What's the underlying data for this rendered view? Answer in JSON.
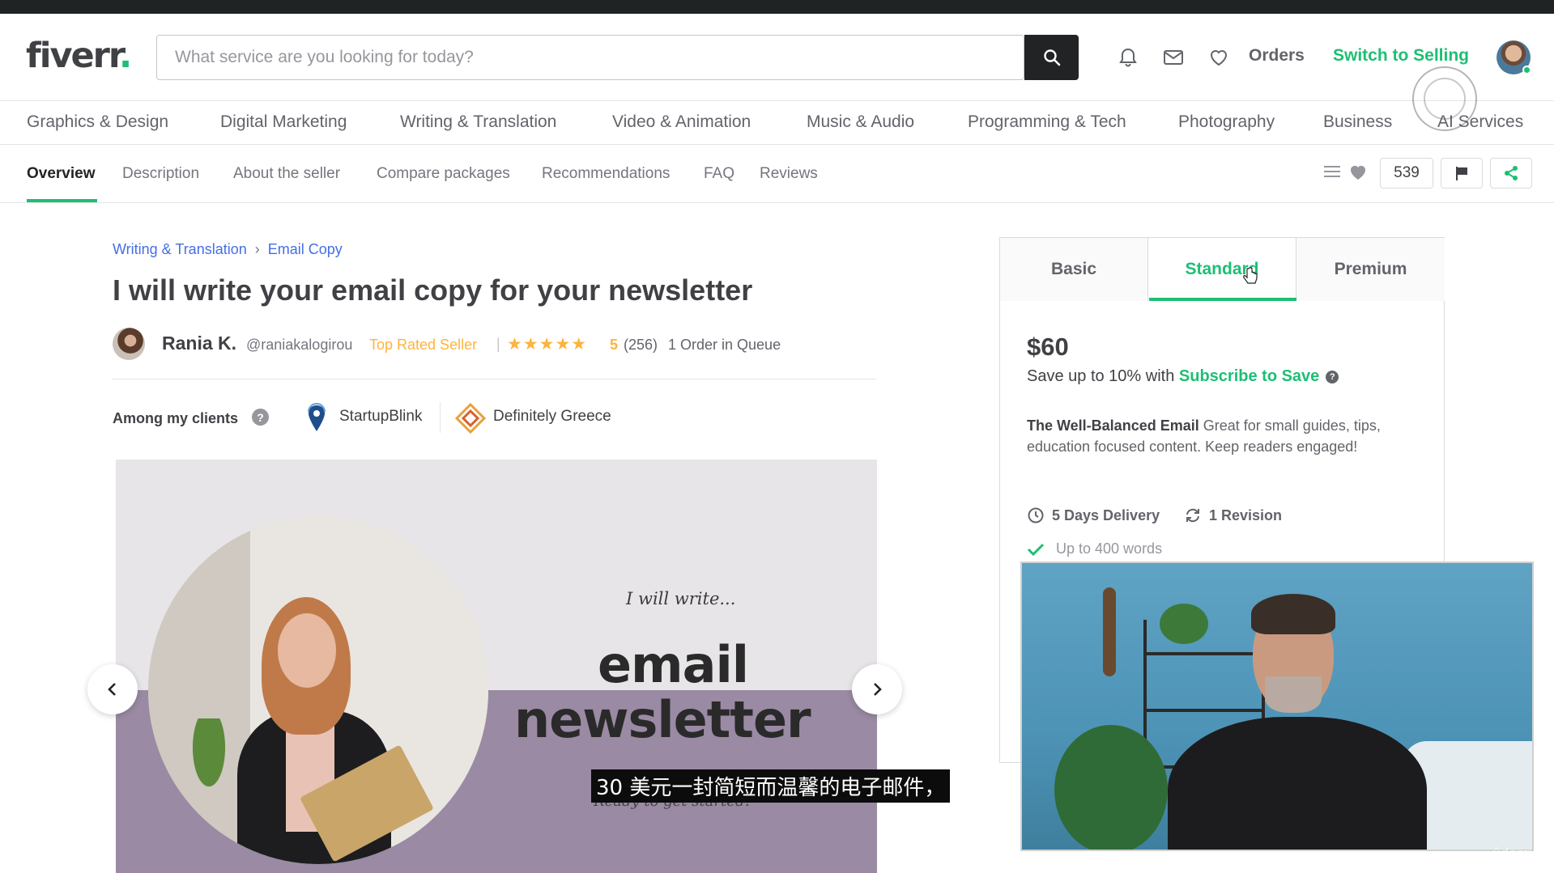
{
  "header": {
    "logo_text": "fiverr",
    "logo_dot": ".",
    "search_placeholder": "What service are you looking for today?",
    "orders_label": "Orders",
    "switch_label": "Switch to Selling",
    "icons": [
      "bell-icon",
      "envelope-icon",
      "heart-icon",
      "search-icon"
    ]
  },
  "categories": [
    "Graphics & Design",
    "Digital Marketing",
    "Writing & Translation",
    "Video & Animation",
    "Music & Audio",
    "Programming & Tech",
    "Photography",
    "Business",
    "AI Services"
  ],
  "subnav": {
    "items": [
      "Overview",
      "Description",
      "About the seller",
      "Compare packages",
      "Recommendations",
      "FAQ",
      "Reviews"
    ],
    "active": "Overview",
    "save_count": "539"
  },
  "breadcrumb": [
    "Writing & Translation",
    "Email Copy"
  ],
  "gig": {
    "title": "I will write your email copy for your newsletter",
    "seller_name": "Rania K.",
    "seller_handle": "@raniakalogirou",
    "seller_level": "Top Rated Seller",
    "stars": "★★★★★",
    "rating": "5",
    "review_count": "(256)",
    "queue": "1 Order in Queue"
  },
  "clients": {
    "label": "Among my clients",
    "items": [
      "StartupBlink",
      "Definitely Greece"
    ]
  },
  "gallery": {
    "kicker": "I will write...",
    "line1": "email",
    "line2": "newsletter",
    "tagline": "Ready to get started?"
  },
  "package": {
    "tabs": [
      "Basic",
      "Standard",
      "Premium"
    ],
    "active_tab": "Standard",
    "price": "$60",
    "save_prefix": "Save up to 10% with",
    "save_link": "Subscribe to Save",
    "desc_title": "The Well-Balanced Email",
    "desc_body": "Great for small guides, tips, education focused content. Keep readers engaged!",
    "delivery": "5 Days Delivery",
    "revisions": "1 Revision",
    "feature": "Up to 400 words"
  },
  "subtitle": "30 美元一封简短而温馨的电子邮件，",
  "watermark": "ûdemy",
  "colors": {
    "brand_green": "#1dbf73",
    "rating_amber": "#ffb33e",
    "link_blue": "#446ee7",
    "text_dark": "#404145"
  }
}
